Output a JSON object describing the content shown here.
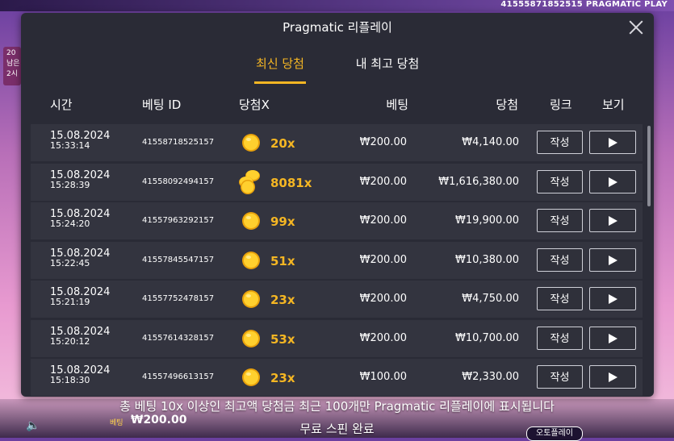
{
  "background": {
    "round_id": "41555871852515",
    "provider": "PRAGMATIC PLAY",
    "left_text": [
      "20",
      "남은",
      "2시"
    ],
    "bet_label": "베팅",
    "bet_value": "₩200.00",
    "autoplay_label": "오토플레이"
  },
  "modal": {
    "title": "Pragmatic 리플레이",
    "tabs": [
      {
        "label": "최신 당첨",
        "active": true
      },
      {
        "label": "내 최고 당첨",
        "active": false
      }
    ],
    "columns": {
      "time": "시간",
      "bet_id": "베팅 ID",
      "win_x": "당첨X",
      "bet": "베팅",
      "win": "당첨",
      "link": "링크",
      "view": "보기"
    },
    "rows": [
      {
        "date": "15.08.2024",
        "time": "15:33:14",
        "bet_id": "41558718525157",
        "multiplier": "20x",
        "coin": "single",
        "bet": "₩200.00",
        "win": "₩4,140.00",
        "link_label": "작성"
      },
      {
        "date": "15.08.2024",
        "time": "15:28:39",
        "bet_id": "41558092494157",
        "multiplier": "8081x",
        "coin": "stack",
        "bet": "₩200.00",
        "win": "₩1,616,380.00",
        "link_label": "작성"
      },
      {
        "date": "15.08.2024",
        "time": "15:24:20",
        "bet_id": "41557963292157",
        "multiplier": "99x",
        "coin": "single",
        "bet": "₩200.00",
        "win": "₩19,900.00",
        "link_label": "작성"
      },
      {
        "date": "15.08.2024",
        "time": "15:22:45",
        "bet_id": "41557845547157",
        "multiplier": "51x",
        "coin": "single",
        "bet": "₩200.00",
        "win": "₩10,380.00",
        "link_label": "작성"
      },
      {
        "date": "15.08.2024",
        "time": "15:21:19",
        "bet_id": "41557752478157",
        "multiplier": "23x",
        "coin": "single",
        "bet": "₩200.00",
        "win": "₩4,750.00",
        "link_label": "작성"
      },
      {
        "date": "15.08.2024",
        "time": "15:20:12",
        "bet_id": "41557614328157",
        "multiplier": "53x",
        "coin": "single",
        "bet": "₩200.00",
        "win": "₩10,700.00",
        "link_label": "작성"
      },
      {
        "date": "15.08.2024",
        "time": "15:18:30",
        "bet_id": "41557496613157",
        "multiplier": "23x",
        "coin": "single",
        "bet": "₩100.00",
        "win": "₩2,330.00",
        "link_label": "작성"
      }
    ]
  },
  "footer": {
    "note": "총 베팅 10x 이상인 최고액 당첨금 최근 100개만 Pragmatic 리플레이에 표시됩니다",
    "status": "무료 스핀 완료"
  },
  "colors": {
    "accent": "#f5b623",
    "modal_bg": "#2a2b36",
    "row_bg": "#33343f"
  }
}
